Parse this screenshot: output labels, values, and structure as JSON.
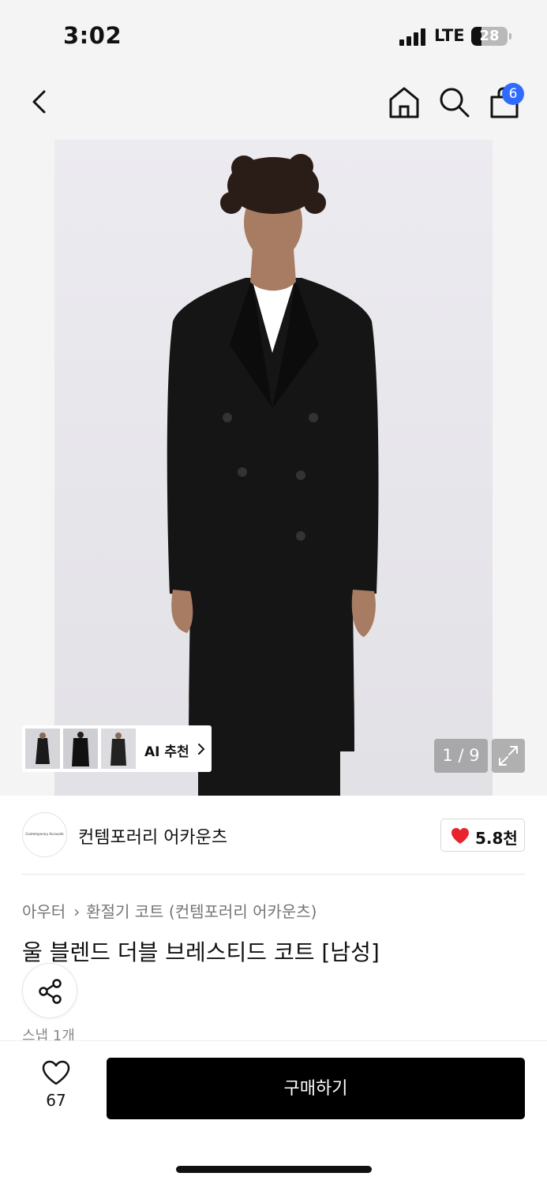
{
  "status_bar": {
    "time": "3:02",
    "network": "LTE",
    "battery": "28",
    "battery_level": 0.28
  },
  "nav": {
    "back_icon": "chevron-left-icon",
    "home_icon": "home-icon",
    "search_icon": "search-icon",
    "cart_icon": "shopping-bag-icon",
    "cart_count": "6"
  },
  "gallery": {
    "page_indicator": "1 / 9",
    "expand_icon": "expand-icon",
    "ai_recommend_label": "AI 추천"
  },
  "brand": {
    "logo_text": "Contemporary Accounts",
    "name": "컨템포러리 어카운츠",
    "likes": "5.8천"
  },
  "product": {
    "breadcrumb": [
      "아우터",
      "환절기 코트 (컨템포러리 어카운츠)"
    ],
    "title": "울 블렌드 더블 브레스티드 코트 [남성]",
    "snap_text": "스냅 1개"
  },
  "bottom": {
    "wish_count": "67",
    "buy_label": "구매하기"
  },
  "colors": {
    "accent_badge": "#2f6bff",
    "heart": "#e8232e",
    "buy_button": "#000000"
  }
}
